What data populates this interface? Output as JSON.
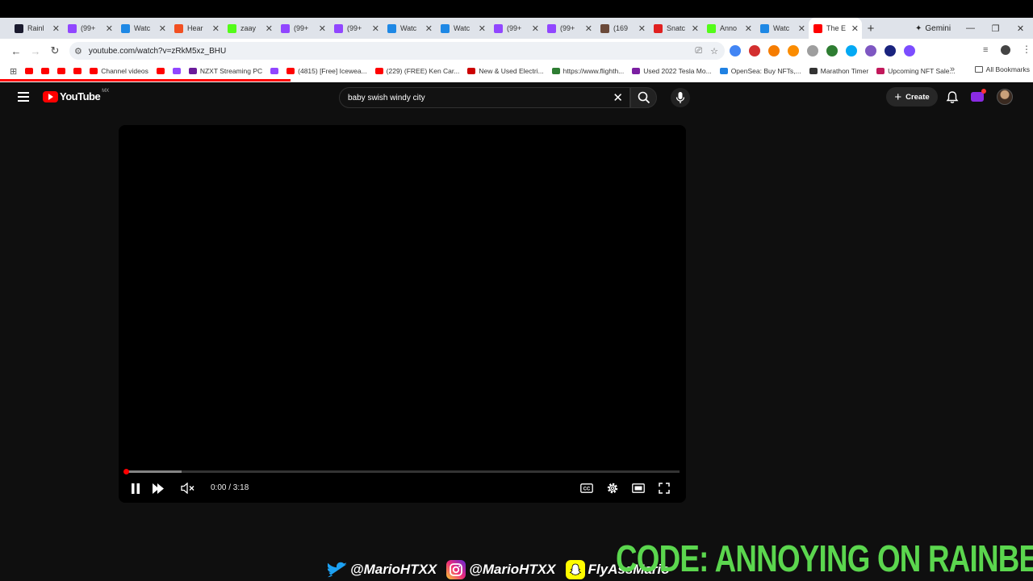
{
  "browser": {
    "tabs": [
      {
        "title": "Rainl",
        "color": "#1a1a2e"
      },
      {
        "title": "(99+",
        "color": "#9146ff"
      },
      {
        "title": "Watc",
        "color": "#1e88e5"
      },
      {
        "title": "Hear",
        "color": "#f25022"
      },
      {
        "title": "zaay",
        "color": "#53fc18"
      },
      {
        "title": "(99+",
        "color": "#9146ff"
      },
      {
        "title": "(99+",
        "color": "#9146ff"
      },
      {
        "title": "Watc",
        "color": "#1e88e5"
      },
      {
        "title": "Watc",
        "color": "#1e88e5"
      },
      {
        "title": "(99+",
        "color": "#9146ff"
      },
      {
        "title": "(99+",
        "color": "#9146ff"
      },
      {
        "title": "(169",
        "color": "#6b4a3a"
      },
      {
        "title": "Snatc",
        "color": "#e02020"
      },
      {
        "title": "Anno",
        "color": "#53fc18"
      },
      {
        "title": "Watc",
        "color": "#1e88e5"
      },
      {
        "title": "The E",
        "color": "#ff0000",
        "active": true
      }
    ],
    "new_tab": "+",
    "gemini_label": "Gemini",
    "url": "youtube.com/watch?v=zRkM5xz_BHU",
    "bookmarks": [
      {
        "label": "",
        "color": "#ff0000"
      },
      {
        "label": "",
        "color": "#ff0000"
      },
      {
        "label": "",
        "color": "#ff0000"
      },
      {
        "label": "",
        "color": "#ff0000"
      },
      {
        "label": "Channel videos",
        "color": "#ff0000"
      },
      {
        "label": "",
        "color": "#ff0000"
      },
      {
        "label": "",
        "color": "#9146ff"
      },
      {
        "label": "NZXT Streaming PC",
        "color": "#6a1b9a"
      },
      {
        "label": "",
        "color": "#9146ff"
      },
      {
        "label": "(4815) [Free] Icewea...",
        "color": "#ff0000"
      },
      {
        "label": "(229) (FREE) Ken Car...",
        "color": "#ff0000"
      },
      {
        "label": "New & Used Electri...",
        "color": "#cc0000"
      },
      {
        "label": "https://www.flighth...",
        "color": "#2e7d32"
      },
      {
        "label": "Used 2022 Tesla Mo...",
        "color": "#7b1fa2"
      },
      {
        "label": "OpenSea: Buy NFTs,...",
        "color": "#2081e2"
      },
      {
        "label": "Marathon Timer",
        "color": "#333333"
      },
      {
        "label": "Upcoming NFT Sale...",
        "color": "#c2185b"
      }
    ],
    "all_bookmarks": "All Bookmarks",
    "extensions": [
      "#4285f4",
      "#d32f2f",
      "#f57c00",
      "#fb8c00",
      "#9e9e9e",
      "#2e7d32",
      "#03a9f4",
      "#7e57c2",
      "#1a237e",
      "#7c4dff"
    ]
  },
  "youtube": {
    "logo_text": "YouTube",
    "region": "MX",
    "search_query": "baby swish windy city",
    "create_label": "Create"
  },
  "player": {
    "time_display": "0:00 / 3:18",
    "progress_fraction": 0.0,
    "buffered_fraction": 0.1
  },
  "overlay": {
    "code_text": "CODE: ANNOYING ON RAINBET",
    "twitter_handle": "@MarioHTXX",
    "instagram_handle": "@MarioHTXX",
    "snapchat_handle": "FlyAssMario"
  }
}
